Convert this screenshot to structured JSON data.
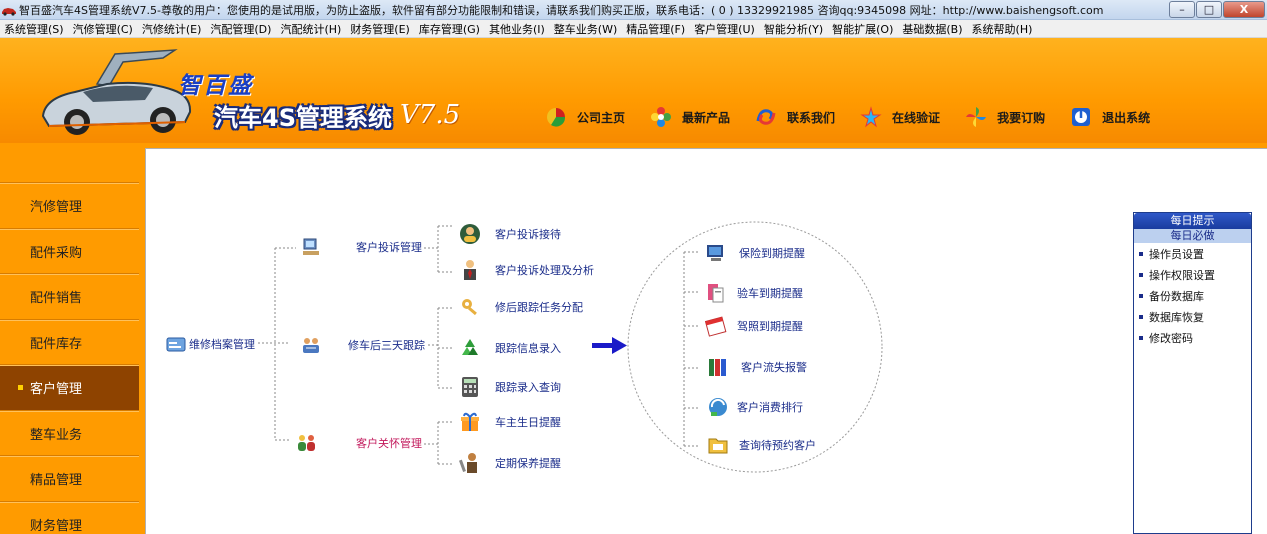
{
  "window": {
    "title": "智百盛汽车4S管理系统V7.5-尊敬的用户：您使用的是试用版，为防止盗版，软件留有部分功能限制和错误，请联系我们购买正版，联系电话：( 0 ) 13329921985  咨询qq:9345098  网址：http://www.baishengsoft.com",
    "min_label": "–",
    "max_label": "□",
    "close_label": "X"
  },
  "menu": [
    "系统管理(S)",
    "汽修管理(C)",
    "汽修统计(E)",
    "汽配管理(D)",
    "汽配统计(H)",
    "财务管理(E)",
    "库存管理(G)",
    "其他业务(I)",
    "整车业务(W)",
    "精品管理(F)",
    "客户管理(U)",
    "智能分析(Y)",
    "智能扩展(O)",
    "基础数据(B)",
    "系统帮助(H)"
  ],
  "header": {
    "brand_small": "智百盛",
    "brand_big": "汽车4S管理系统",
    "version": "V7.5",
    "links": [
      {
        "label": "公司主页",
        "icon": "pie-globe-icon"
      },
      {
        "label": "最新产品",
        "icon": "flower-icon"
      },
      {
        "label": "联系我们",
        "icon": "swirl-icon"
      },
      {
        "label": "在线验证",
        "icon": "star-icon"
      },
      {
        "label": "我要订购",
        "icon": "pinwheel-icon"
      },
      {
        "label": "退出系统",
        "icon": "exit-icon"
      }
    ]
  },
  "sidebar": {
    "items": [
      {
        "label": "汽修管理",
        "active": false
      },
      {
        "label": "配件采购",
        "active": false
      },
      {
        "label": "配件销售",
        "active": false
      },
      {
        "label": "配件库存",
        "active": false
      },
      {
        "label": "客户管理",
        "active": true
      },
      {
        "label": "整车业务",
        "active": false
      },
      {
        "label": "精品管理",
        "active": false
      },
      {
        "label": "财务管理",
        "active": false
      }
    ]
  },
  "flow": {
    "root": "维修档案管理",
    "branches": {
      "complaint": "客户投诉管理",
      "followup": "修车后三天跟踪",
      "care": "客户关怀管理"
    },
    "leaves": {
      "complaint_receive": "客户投诉接待",
      "complaint_analysis": "客户投诉处理及分析",
      "followup_assign": "修后跟踪任务分配",
      "followup_entry": "跟踪信息录入",
      "followup_query": "跟踪录入查询",
      "birthday": "车主生日提醒",
      "maintenance": "定期保养提醒"
    },
    "reminders": {
      "insurance": "保险到期提醒",
      "inspection": "验车到期提醒",
      "license": "驾照到期提醒",
      "churn": "客户流失报警",
      "ranking": "客户消费排行",
      "booking": "查询待预约客户"
    }
  },
  "tips": {
    "title": "每日提示",
    "subtitle": "每日必做",
    "items": [
      "操作员设置",
      "操作权限设置",
      "备份数据库",
      "数据库恢复",
      "修改密码"
    ]
  },
  "colors": {
    "accent_orange": "#ff9b00",
    "active_sidebar": "#8e4300",
    "link_blue": "#1a2c8a",
    "care_pink": "#c2185b"
  }
}
